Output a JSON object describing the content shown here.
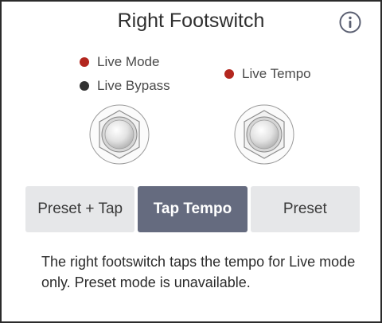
{
  "header": {
    "title": "Right Footswitch",
    "info_icon": "info-icon"
  },
  "legend": {
    "left": [
      {
        "label": "Live Mode",
        "color": "#b3261e"
      },
      {
        "label": "Live Bypass",
        "color": "#333333"
      }
    ],
    "right": [
      {
        "label": "Live Tempo",
        "color": "#b3261e"
      }
    ]
  },
  "footswitches": {
    "left_icon": "footswitch-icon",
    "right_icon": "footswitch-icon"
  },
  "modes": {
    "options": [
      "Preset + Tap",
      "Tap Tempo",
      "Preset"
    ],
    "selected": "Tap Tempo",
    "active_color": "#656b7f",
    "inactive_color": "#e6e7e9"
  },
  "description": "The right footswitch taps the tempo for Live mode only. Preset mode is unavailable."
}
